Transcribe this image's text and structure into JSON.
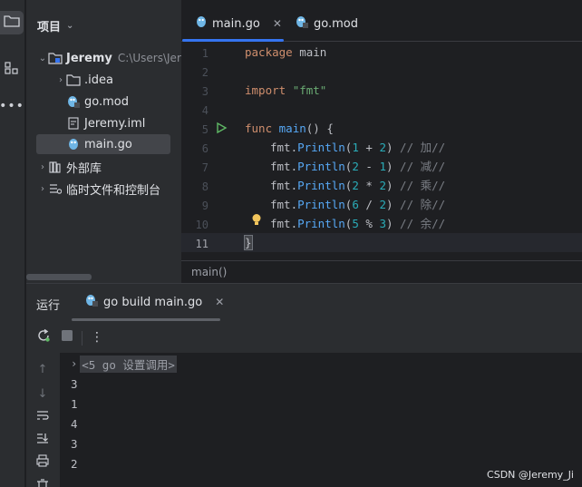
{
  "project": {
    "header": "项目",
    "tree": [
      {
        "label": "Jeremy",
        "sub": "C:\\Users\\Jer",
        "kind": "root",
        "expanded": true
      },
      {
        "label": ".idea",
        "kind": "folder",
        "expanded": false
      },
      {
        "label": "go.mod",
        "kind": "gomod"
      },
      {
        "label": "Jeremy.iml",
        "kind": "iml"
      },
      {
        "label": "main.go",
        "kind": "gofile",
        "selected": true
      },
      {
        "label": "外部库",
        "kind": "library"
      },
      {
        "label": "临时文件和控制台",
        "kind": "scratch"
      }
    ]
  },
  "editor": {
    "tabs": [
      {
        "label": "main.go",
        "active": true,
        "closable": true
      },
      {
        "label": "go.mod",
        "active": false
      }
    ],
    "line_numbers": [
      "1",
      "2",
      "3",
      "4",
      "5",
      "6",
      "7",
      "8",
      "9",
      "10",
      "11"
    ],
    "code": {
      "l1_kw": "package",
      "l1_name": "main",
      "l3_kw": "import",
      "l3_str": "\"fmt\"",
      "l5_kw": "func",
      "l5_fn": "main",
      "l5_rest": "() {",
      "calls": [
        {
          "pkg": "fmt",
          "fn": "Println",
          "a": "1",
          "op": "+",
          "b": "2",
          "comment": "// 加//"
        },
        {
          "pkg": "fmt",
          "fn": "Println",
          "a": "2",
          "op": "-",
          "b": "1",
          "comment": "// 减//"
        },
        {
          "pkg": "fmt",
          "fn": "Println",
          "a": "2",
          "op": "*",
          "b": "2",
          "comment": "// 乘//"
        },
        {
          "pkg": "fmt",
          "fn": "Println",
          "a": "6",
          "op": "/",
          "b": "2",
          "comment": "// 除//"
        },
        {
          "pkg": "fmt",
          "fn": "Println",
          "a": "5",
          "op": "%",
          "b": "3",
          "comment": "// 余//"
        }
      ],
      "l11": "}"
    },
    "breadcrumb": "main()"
  },
  "run": {
    "title": "运行",
    "tab_label": "go build main.go",
    "command": "<5 go 设置调用>",
    "output": [
      "3",
      "1",
      "4",
      "3",
      "2"
    ]
  },
  "watermark": "CSDN @Jeremy_Ji",
  "colors": {
    "accent": "#3574f0",
    "keyword": "#cf8e6d",
    "string": "#6aab73",
    "function": "#56a8f5",
    "number": "#2aacb8",
    "comment": "#7a7e85",
    "run_green": "#5fb865",
    "bulb": "#f2c55c"
  }
}
